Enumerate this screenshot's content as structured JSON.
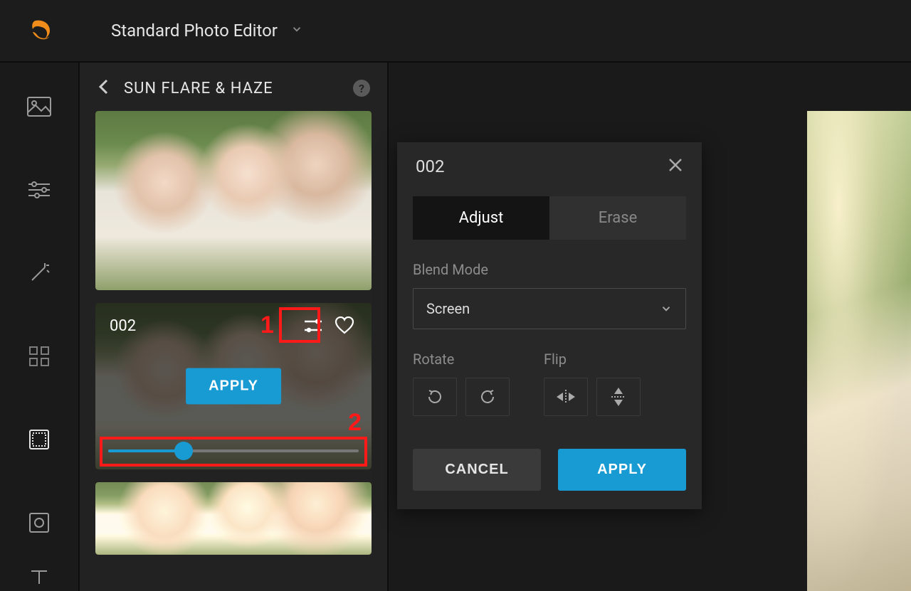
{
  "header": {
    "app_title": "Standard Photo Editor"
  },
  "panel": {
    "title": "SUN FLARE & HAZE",
    "active_effect_id": "002",
    "apply_label": "APPLY",
    "slider_percent": 30,
    "annotations": {
      "settings": "1",
      "slider": "2"
    }
  },
  "dialog": {
    "title": "002",
    "tabs": {
      "adjust": "Adjust",
      "erase": "Erase"
    },
    "blend_label": "Blend Mode",
    "blend_value": "Screen",
    "rotate_label": "Rotate",
    "flip_label": "Flip",
    "cancel": "CANCEL",
    "apply": "APPLY"
  },
  "colors": {
    "accent": "#189ad3",
    "annotation": "#ff1a1a"
  }
}
